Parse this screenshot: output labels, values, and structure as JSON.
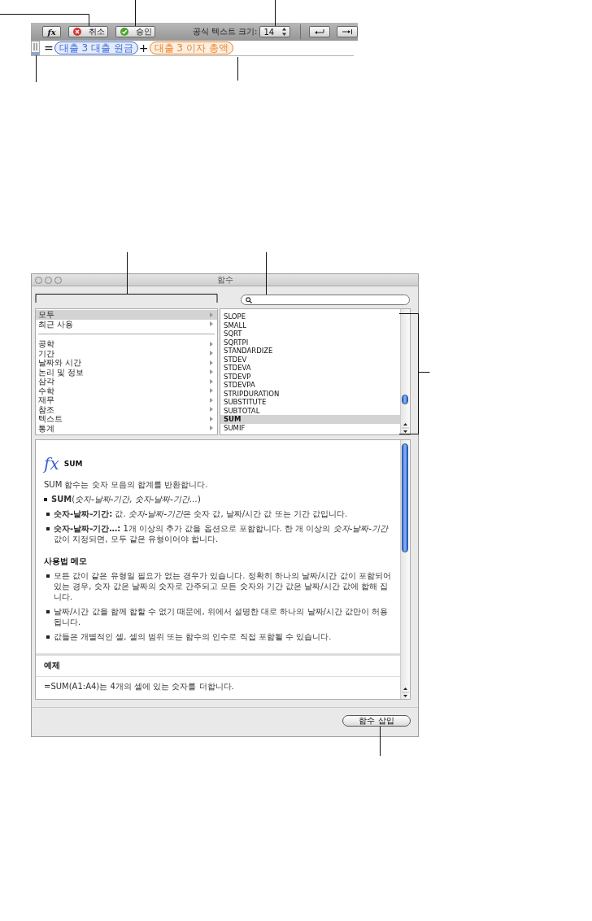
{
  "formula_editor": {
    "toolbar": {
      "function_button": "fx",
      "cancel_button": "취소",
      "accept_button": "승인",
      "text_size_label": "공식 텍스트 크기:",
      "text_size_value": "14"
    },
    "formula": [
      {
        "kind": "operator",
        "text": "="
      },
      {
        "kind": "token",
        "text": "대출 3 대출 원금",
        "color": "#3d6fd8"
      },
      {
        "kind": "operator",
        "text": "+"
      },
      {
        "kind": "token",
        "text": "대출 3 이자 총액",
        "color": "#e8862a"
      }
    ]
  },
  "functions_dialog": {
    "title": "함수",
    "category_groups": [
      [
        {
          "label": "모두",
          "selected": true
        },
        {
          "label": "최근 사용",
          "selected": false
        }
      ],
      [
        {
          "label": "공학",
          "selected": false
        },
        {
          "label": "기간",
          "selected": false
        },
        {
          "label": "날짜와 시간",
          "selected": false
        },
        {
          "label": "논리 및 정보",
          "selected": false
        },
        {
          "label": "삼각",
          "selected": false
        },
        {
          "label": "수학",
          "selected": false
        },
        {
          "label": "재무",
          "selected": false
        },
        {
          "label": "참조",
          "selected": false
        },
        {
          "label": "텍스트",
          "selected": false
        },
        {
          "label": "통계",
          "selected": false
        }
      ]
    ],
    "functions": [
      {
        "label": "SLOPE",
        "selected": false
      },
      {
        "label": "SMALL",
        "selected": false
      },
      {
        "label": "SQRT",
        "selected": false
      },
      {
        "label": "SQRTPI",
        "selected": false
      },
      {
        "label": "STANDARDIZE",
        "selected": false
      },
      {
        "label": "STDEV",
        "selected": false
      },
      {
        "label": "STDEVA",
        "selected": false
      },
      {
        "label": "STDEVP",
        "selected": false
      },
      {
        "label": "STDEVPA",
        "selected": false
      },
      {
        "label": "STRIPDURATION",
        "selected": false
      },
      {
        "label": "SUBSTITUTE",
        "selected": false
      },
      {
        "label": "SUBTOTAL",
        "selected": false
      },
      {
        "label": "SUM",
        "selected": true
      },
      {
        "label": "SUMIF",
        "selected": false
      }
    ],
    "description": {
      "symbol": "fx",
      "title": "SUM",
      "summary": "SUM 함수는 숫자 모음의 합계를 반환합니다.",
      "syntax": "**SUM**(*숫자-날짜-기간, 숫자-날짜-기간…*)",
      "arguments": [
        [
          {
            "kind": "term",
            "text": "숫자-날짜-기간:"
          },
          {
            "kind": "text",
            "text": " 값. "
          },
          {
            "kind": "parameter",
            "text": "숫자-날짜-기간"
          },
          {
            "kind": "text",
            "text": "은 숫자 값, 날짜/시간 값 또는 기간 값입니다."
          }
        ],
        [
          {
            "kind": "term",
            "text": "숫자-날짜-기간…:"
          },
          {
            "kind": "text",
            "text": " 1개 이상의 추가 값을 옵션으로 포함합니다. 한 개 이상의 "
          },
          {
            "kind": "parameter",
            "text": "숫자-날짜-기간"
          },
          {
            "kind": "text",
            "text": " 값이 지정되면, 모두 같은 유형이어야 합니다."
          }
        ]
      ],
      "notes_heading": "사용법 메모",
      "notes": [
        "모든 값이 같은 유형일 필요가 없는 경우가 있습니다. 정확히 하나의 날짜/시간 값이 포함되어 있는 경우, 숫자 값은 날짜의 숫자로 간주되고 모든 숫자와 기간 값은 날짜/시간 값에 합해 집니다.",
        "날짜/시간 값을 함께 합할 수 없기 때문에, 위에서 설명한 대로 하나의 날짜/시간 값만이 허용됩니다.",
        "값들은 개별적인 셀, 셀의 범위 또는 함수의 인수로 직접 포함될 수 있습니다."
      ],
      "example_heading": "예제",
      "example": "=SUM(A1:A4)는 4개의 셀에 있는 숫자를 더합니다."
    },
    "insert_button": "함수 삽입"
  }
}
